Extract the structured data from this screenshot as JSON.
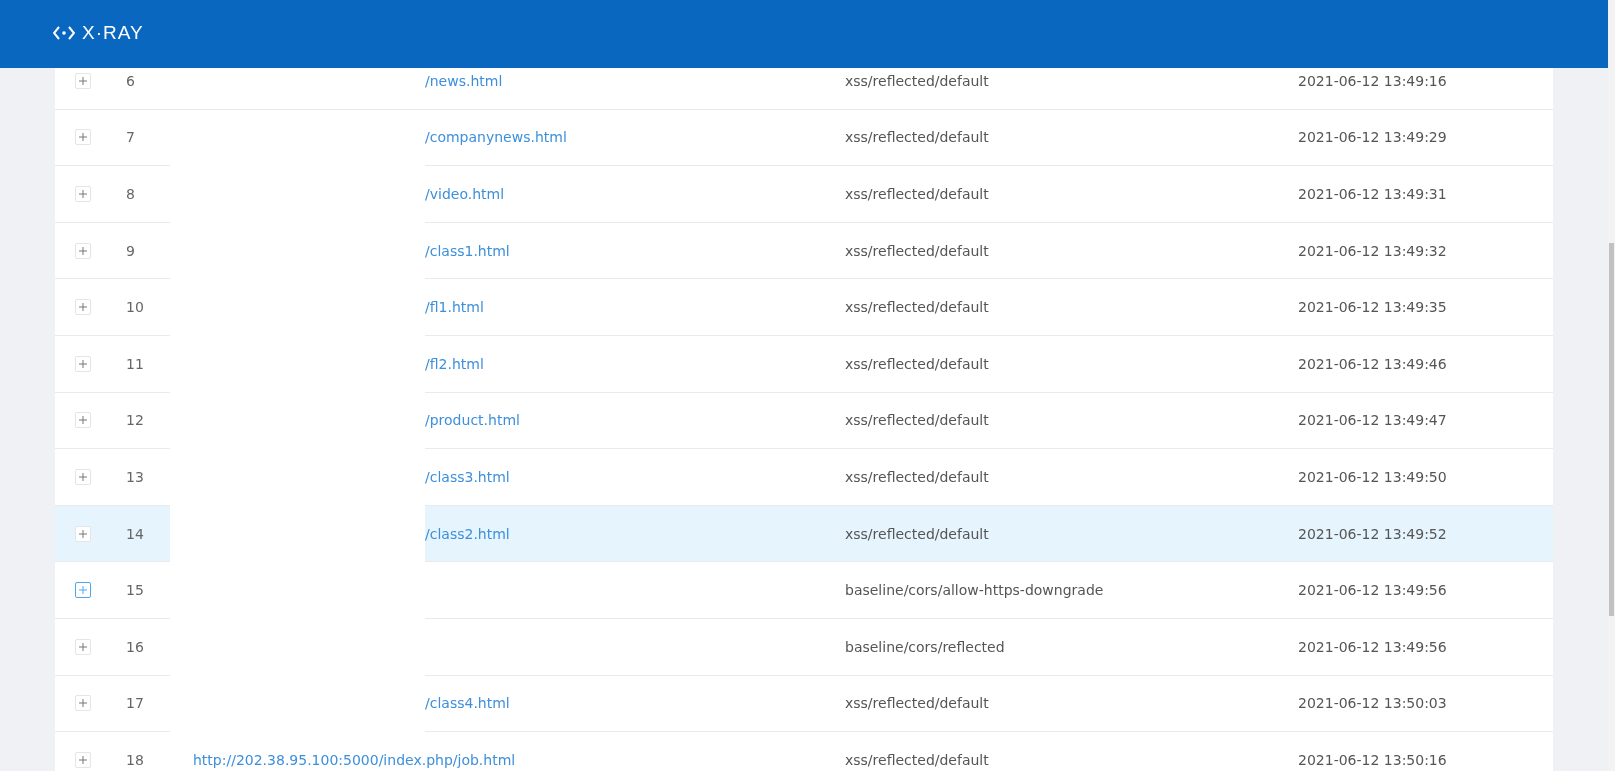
{
  "header": {
    "logo_text": "X·RAY"
  },
  "rows": [
    {
      "index": "6",
      "url": "/news.html",
      "redacted": true,
      "vuln_type": "xss/reflected/default",
      "time": "2021-06-12 13:49:16",
      "highlighted": false,
      "focused": false
    },
    {
      "index": "7",
      "url": "/companynews.html",
      "redacted": true,
      "vuln_type": "xss/reflected/default",
      "time": "2021-06-12 13:49:29",
      "highlighted": false,
      "focused": false
    },
    {
      "index": "8",
      "url": "/video.html",
      "redacted": true,
      "vuln_type": "xss/reflected/default",
      "time": "2021-06-12 13:49:31",
      "highlighted": false,
      "focused": false
    },
    {
      "index": "9",
      "url": "/class1.html",
      "redacted": true,
      "vuln_type": "xss/reflected/default",
      "time": "2021-06-12 13:49:32",
      "highlighted": false,
      "focused": false
    },
    {
      "index": "10",
      "url": "/fl1.html",
      "redacted": true,
      "vuln_type": "xss/reflected/default",
      "time": "2021-06-12 13:49:35",
      "highlighted": false,
      "focused": false
    },
    {
      "index": "11",
      "url": "/fl2.html",
      "redacted": true,
      "vuln_type": "xss/reflected/default",
      "time": "2021-06-12 13:49:46",
      "highlighted": false,
      "focused": false
    },
    {
      "index": "12",
      "url": "/product.html",
      "redacted": true,
      "vuln_type": "xss/reflected/default",
      "time": "2021-06-12 13:49:47",
      "highlighted": false,
      "focused": false
    },
    {
      "index": "13",
      "url": "/class3.html",
      "redacted": true,
      "vuln_type": "xss/reflected/default",
      "time": "2021-06-12 13:49:50",
      "highlighted": false,
      "focused": false
    },
    {
      "index": "14",
      "url": "/class2.html",
      "redacted": true,
      "vuln_type": "xss/reflected/default",
      "time": "2021-06-12 13:49:52",
      "highlighted": true,
      "focused": false
    },
    {
      "index": "15",
      "redacted": true,
      "vuln_type": "baseline/cors/allow-https-downgrade",
      "time": "2021-06-12 13:49:56",
      "highlighted": false,
      "focused": true
    },
    {
      "index": "16",
      "redacted": true,
      "vuln_type": "baseline/cors/reflected",
      "time": "2021-06-12 13:49:56",
      "highlighted": false,
      "focused": false
    },
    {
      "index": "17",
      "url": "/class4.html",
      "redacted": true,
      "vuln_type": "xss/reflected/default",
      "time": "2021-06-12 13:50:03",
      "highlighted": false,
      "focused": false
    },
    {
      "index": "18",
      "url": "http://202.38.95.100:5000/index.php/job.html",
      "redacted": false,
      "vuln_type": "xss/reflected/default",
      "time": "2021-06-12 13:50:16",
      "highlighted": false,
      "focused": false
    }
  ]
}
